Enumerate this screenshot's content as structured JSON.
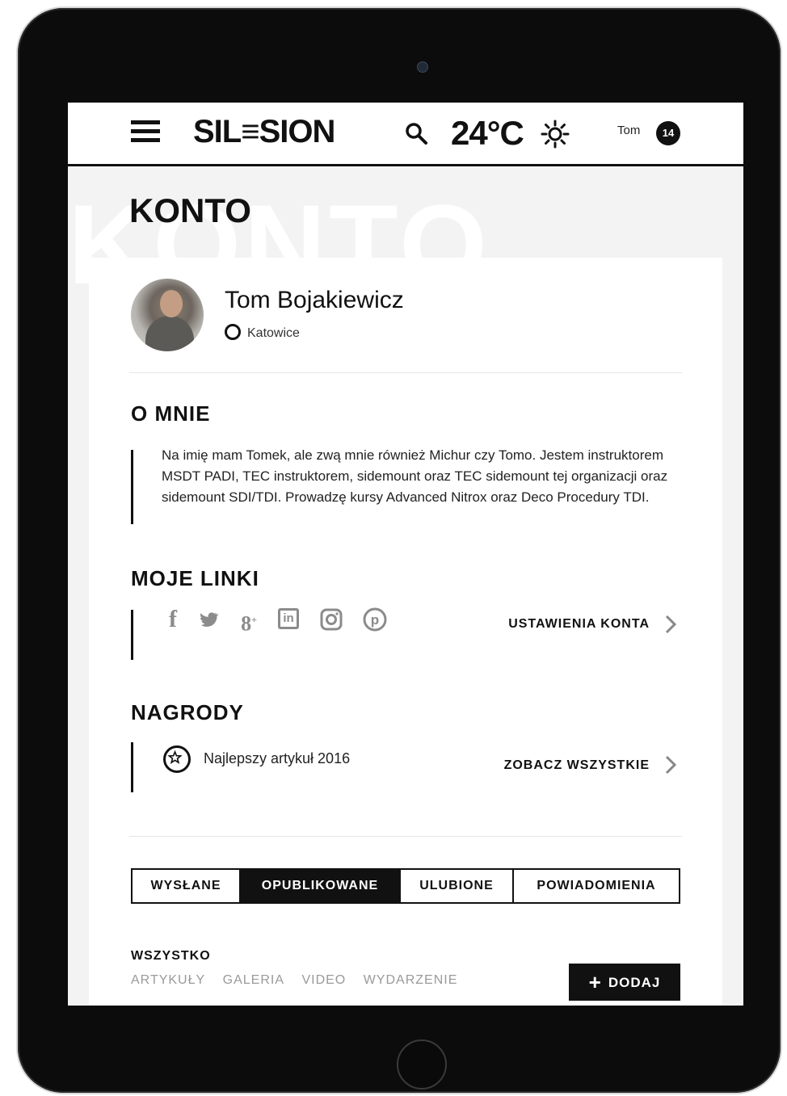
{
  "header": {
    "logo": "SIL≡SION",
    "temperature": "24°C",
    "user": "Tom",
    "notifications": "14"
  },
  "page": {
    "title": "KONTO",
    "watermark": "KONTO"
  },
  "profile": {
    "name": "Tom Bojakiewicz",
    "location": "Katowice"
  },
  "about": {
    "title": "O MNIE",
    "text": "Na imię mam Tomek, ale zwą mnie również Michur czy Tomo. Jestem instruktorem MSDT PADI, TEC instruktorem, sidemount oraz TEC sidemount tej organizacji oraz sidemount SDI/TDI. Prowadzę kursy Advanced Nitrox oraz Deco Procedury TDI."
  },
  "links": {
    "title": "MOJE LINKI",
    "social_icons": [
      "facebook-icon",
      "twitter-icon",
      "google-plus-icon",
      "linkedin-icon",
      "instagram-icon",
      "pinterest-icon"
    ],
    "settings_label": "USTAWIENIA KONTA"
  },
  "awards": {
    "title": "NAGRODY",
    "item": "Najlepszy artykuł 2016",
    "see_all_label": "ZOBACZ WSZYSTKIE"
  },
  "tabs": {
    "items": [
      {
        "label": "WYSŁANE",
        "active": false
      },
      {
        "label": "OPUBLIKOWANE",
        "active": true
      },
      {
        "label": "ULUBIONE",
        "active": false
      },
      {
        "label": "POWIADOMIENIA",
        "active": false
      }
    ]
  },
  "filters": {
    "title": "WSZYSTKO",
    "items": [
      "ARTYKUŁY",
      "GALERIA",
      "VIDEO",
      "WYDARZENIE"
    ],
    "add_label": "DODAJ"
  },
  "colors": {
    "accent": "#111111",
    "muted": "#9a9a9a"
  }
}
